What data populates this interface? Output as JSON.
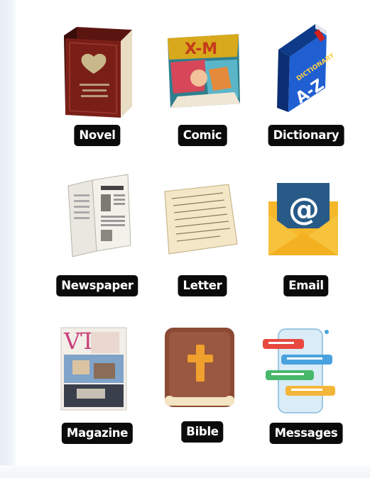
{
  "items": [
    {
      "label": "Novel",
      "icon": "novel-book-icon"
    },
    {
      "label": "Comic",
      "icon": "comic-book-icon"
    },
    {
      "label": "Dictionary",
      "icon": "dictionary-icon"
    },
    {
      "label": "Newspaper",
      "icon": "newspaper-icon"
    },
    {
      "label": "Letter",
      "icon": "letter-icon"
    },
    {
      "label": "Email",
      "icon": "email-icon"
    },
    {
      "label": "Magazine",
      "icon": "magazine-icon"
    },
    {
      "label": "Bible",
      "icon": "bible-icon"
    },
    {
      "label": "Messages",
      "icon": "messages-icon"
    }
  ]
}
